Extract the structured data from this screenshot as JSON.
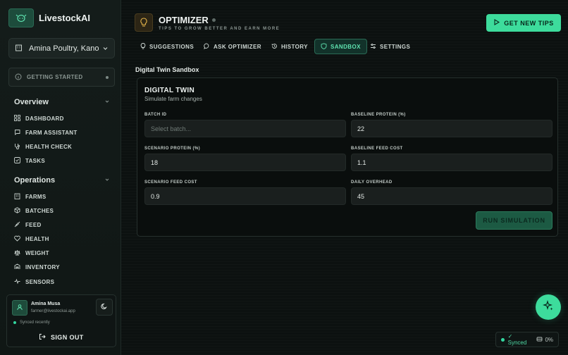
{
  "app": {
    "name": "LivestockAI"
  },
  "sidebar": {
    "farm_selector": {
      "value": "Amina Poultry, Kano"
    },
    "getting_started": {
      "label": "GETTING STARTED"
    },
    "sections": [
      {
        "title": "Overview",
        "items": [
          {
            "label": "DASHBOARD",
            "icon": "grid-icon"
          },
          {
            "label": "FARM ASSISTANT",
            "icon": "chat-icon"
          },
          {
            "label": "HEALTH CHECK",
            "icon": "stethoscope-icon"
          },
          {
            "label": "TASKS",
            "icon": "checkbox-icon"
          }
        ]
      },
      {
        "title": "Operations",
        "items": [
          {
            "label": "FARMS",
            "icon": "building-icon"
          },
          {
            "label": "BATCHES",
            "icon": "box-icon"
          },
          {
            "label": "FEED",
            "icon": "wheat-icon"
          },
          {
            "label": "HEALTH",
            "icon": "heart-icon"
          },
          {
            "label": "WEIGHT",
            "icon": "scale-icon"
          },
          {
            "label": "INVENTORY",
            "icon": "warehouse-icon"
          },
          {
            "label": "SENSORS",
            "icon": "pulse-icon"
          }
        ]
      }
    ],
    "profile": {
      "name": "Amina Musa",
      "email": "farmer@livestockai.app",
      "sync_status": "Synced recently",
      "sign_out": "SIGN OUT"
    }
  },
  "header": {
    "title": "OPTIMIZER",
    "subtitle": "TIPS TO GROW BETTER AND EARN MORE",
    "primary_action": "GET NEW TIPS"
  },
  "tabs": [
    {
      "label": "SUGGESTIONS",
      "icon": "lightbulb-icon",
      "active": false
    },
    {
      "label": "ASK OPTIMIZER",
      "icon": "chat-icon",
      "active": false
    },
    {
      "label": "HISTORY",
      "icon": "history-icon",
      "active": false
    },
    {
      "label": "SANDBOX",
      "icon": "shield-icon",
      "active": true
    },
    {
      "label": "SETTINGS",
      "icon": "sliders-icon",
      "active": false
    }
  ],
  "sandbox": {
    "heading": "Digital Twin Sandbox",
    "panel_title": "DIGITAL TWIN",
    "panel_subtitle": "Simulate farm changes",
    "fields": {
      "batch_id": {
        "label": "BATCH ID",
        "value": "",
        "placeholder": "Select batch..."
      },
      "baseline_protein": {
        "label": "BASELINE PROTEIN (%)",
        "value": "22"
      },
      "scenario_protein": {
        "label": "SCENARIO PROTEIN (%)",
        "value": "18"
      },
      "baseline_feed_cost": {
        "label": "BASELINE FEED COST",
        "value": "1.1"
      },
      "scenario_feed_cost": {
        "label": "SCENARIO FEED COST",
        "value": "0.9"
      },
      "daily_overhead": {
        "label": "DAILY OVERHEAD",
        "value": "45"
      }
    },
    "run_button": "RUN SIMULATION"
  },
  "status": {
    "sync": "Synced",
    "storage": "0%"
  },
  "colors": {
    "accent": "#3ddc9c",
    "background": "#0c1110",
    "sidebar": "#141c1a"
  }
}
